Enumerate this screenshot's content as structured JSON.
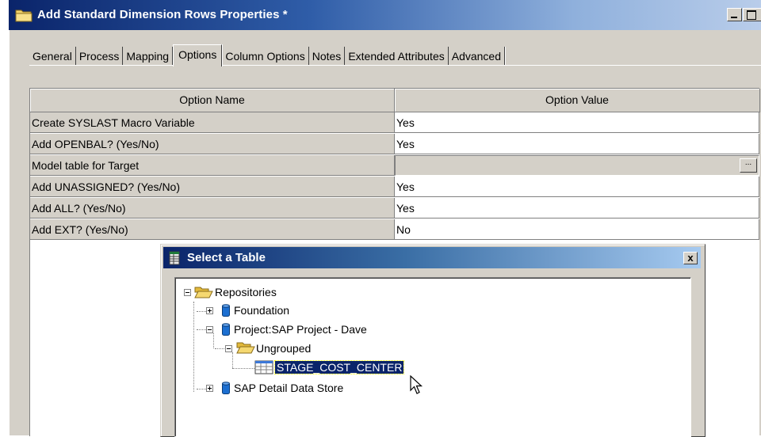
{
  "window": {
    "title": "Add Standard Dimension Rows Properties *"
  },
  "tabs": [
    {
      "label": "General",
      "active": false
    },
    {
      "label": "Process",
      "active": false
    },
    {
      "label": "Mapping",
      "active": false
    },
    {
      "label": "Options",
      "active": true
    },
    {
      "label": "Column Options",
      "active": false
    },
    {
      "label": "Notes",
      "active": false
    },
    {
      "label": "Extended Attributes",
      "active": false
    },
    {
      "label": "Advanced",
      "active": false
    }
  ],
  "options_grid": {
    "headers": {
      "name": "Option Name",
      "value": "Option Value"
    },
    "rows": [
      {
        "name": "Create SYSLAST Macro Variable",
        "value": "Yes"
      },
      {
        "name": "Add OPENBAL? (Yes/No)",
        "value": "Yes"
      },
      {
        "name": "Model table for Target",
        "value": "",
        "button": "..."
      },
      {
        "name": "Add UNASSIGNED? (Yes/No)",
        "value": "Yes"
      },
      {
        "name": "Add ALL? (Yes/No)",
        "value": "Yes"
      },
      {
        "name": "Add EXT?  (Yes/No)",
        "value": "No"
      }
    ]
  },
  "dialog": {
    "title": "Select a Table",
    "close_label": "x",
    "tree": {
      "root": "Repositories",
      "foundation": "Foundation",
      "project": "Project:SAP Project - Dave",
      "ungrouped": "Ungrouped",
      "table": "STAGE_COST_CENTER",
      "detail_store": "SAP Detail Data Store"
    }
  },
  "colors": {
    "title_gradient_start": "#0a246a",
    "window_face": "#d4d0c8",
    "selection": "#0a246a"
  }
}
